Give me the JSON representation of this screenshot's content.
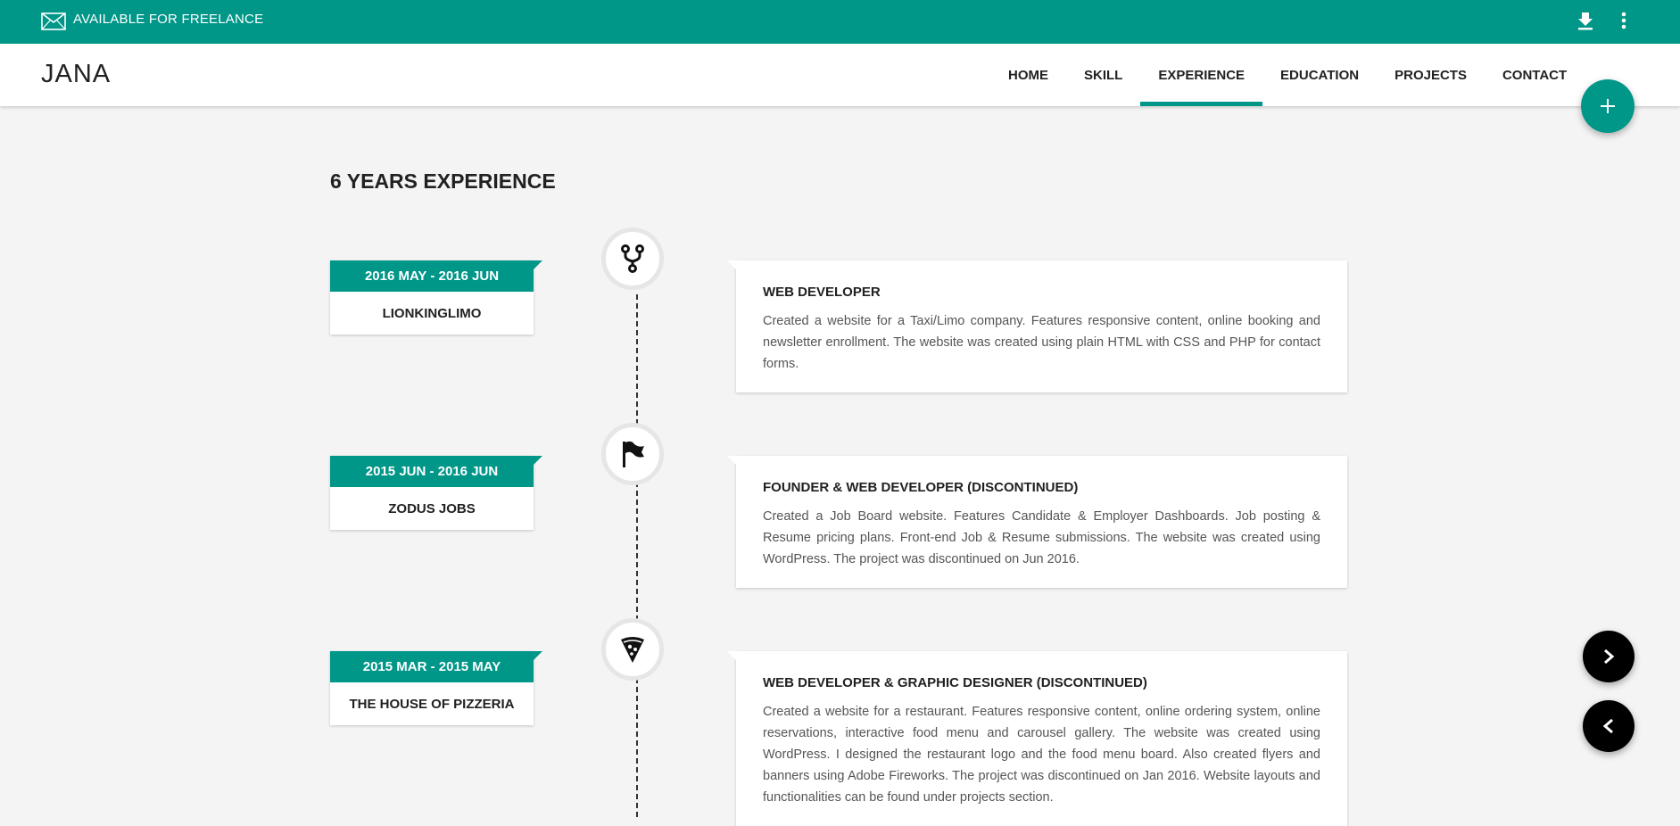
{
  "topbar": {
    "availability": "AVAILABLE FOR FREELANCE",
    "icons": [
      "mail-icon",
      "download-icon",
      "more-vert-icon"
    ]
  },
  "header": {
    "logo": "JANA",
    "nav": [
      {
        "label": "HOME",
        "active": false
      },
      {
        "label": "SKILL",
        "active": false
      },
      {
        "label": "EXPERIENCE",
        "active": true
      },
      {
        "label": "EDUCATION",
        "active": false
      },
      {
        "label": "PROJECTS",
        "active": false
      },
      {
        "label": "CONTACT",
        "active": false
      }
    ]
  },
  "section": {
    "title": "6 YEARS EXPERIENCE"
  },
  "experience": [
    {
      "period": "2016 MAY - 2016 JUN",
      "company": "LIONKINGLIMO",
      "icon": "fork-icon",
      "role": "WEB DEVELOPER",
      "description": "Created a website for a Taxi/Limo company. Features responsive content, online booking and newsletter enrollment. The website was created using plain HTML with CSS and PHP for contact forms."
    },
    {
      "period": "2015 JUN - 2016 JUN",
      "company": "ZODUS JOBS",
      "icon": "flag-icon",
      "role": "FOUNDER & WEB DEVELOPER (DISCONTINUED)",
      "description": "Created a Job Board website. Features Candidate & Employer Dashboards. Job posting & Resume pricing plans. Front-end Job & Resume submissions. The website was created using WordPress. The project was discontinued on Jun 2016."
    },
    {
      "period": "2015 MAR - 2015 MAY",
      "company": "THE HOUSE OF PIZZERIA",
      "icon": "pizza-icon",
      "role": "WEB DEVELOPER & GRAPHIC DESIGNER (DISCONTINUED)",
      "description": "Created a website for a restaurant. Features responsive content, online ordering system, online reservations, interactive food menu and carousel gallery. The website was created using WordPress. I designed the restaurant logo and the food menu board. Also created flyers and banners using Adobe Fireworks. The project was discontinued on Jan 2016. Website layouts and functionalities can be found under projects section."
    }
  ],
  "colors": {
    "accent": "#009688",
    "background": "#f4f4f4",
    "text": "#212121"
  }
}
